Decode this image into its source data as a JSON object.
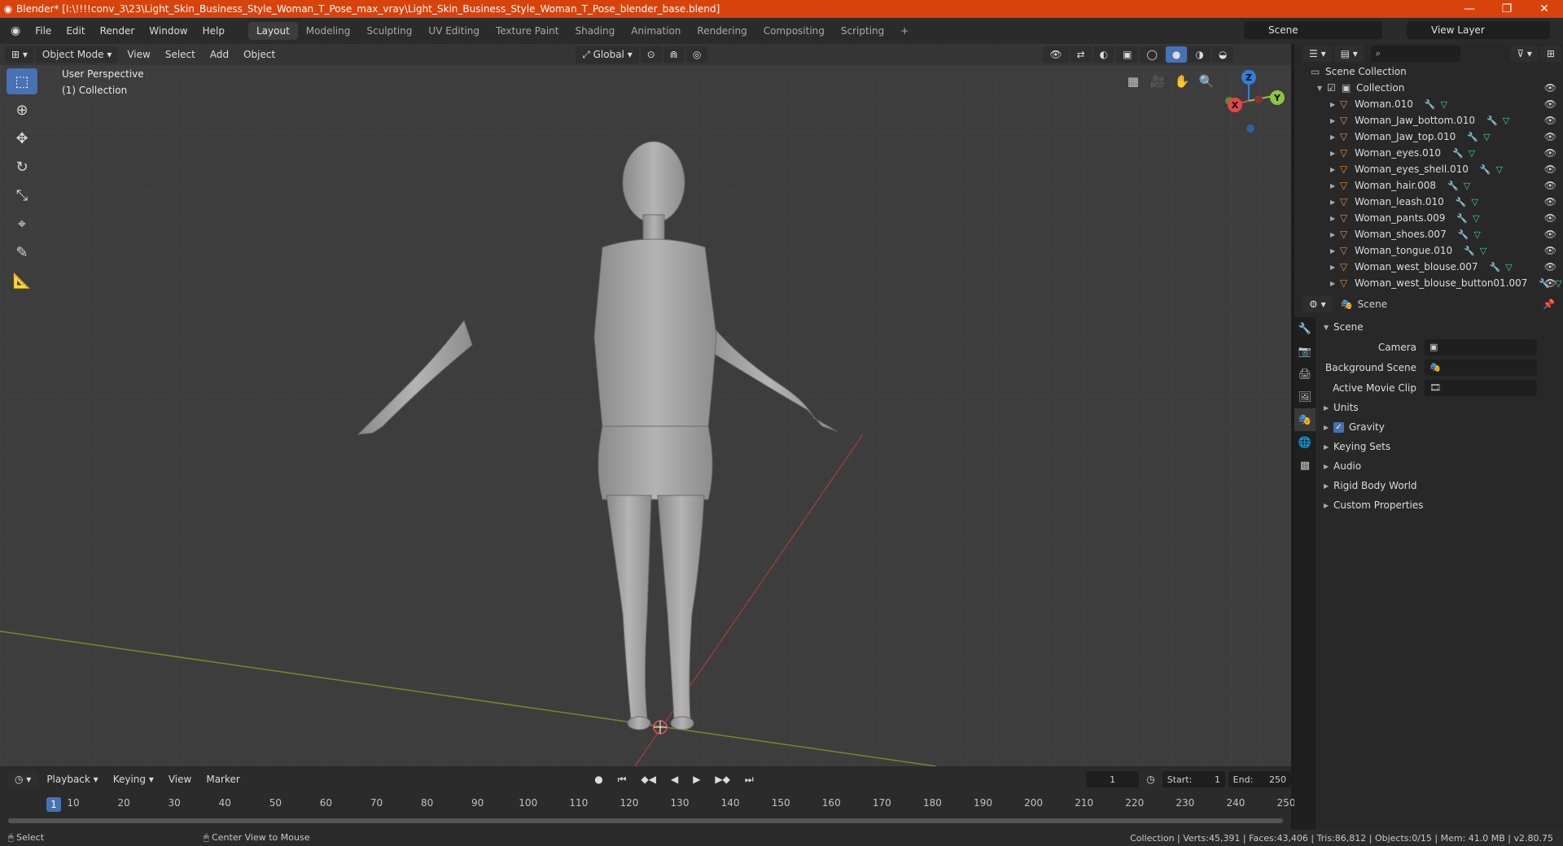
{
  "app": {
    "title": "Blender* [I:\\!!!!conv_3\\23\\Light_Skin_Business_Style_Woman_T_Pose_max_vray\\Light_Skin_Business_Style_Woman_T_Pose_blender_base.blend]",
    "logo_glyph": "◉",
    "controls": {
      "minimize": "—",
      "maximize": "❐",
      "close": "✕"
    }
  },
  "menu": [
    "File",
    "Edit",
    "Render",
    "Window",
    "Help"
  ],
  "workspaces": [
    "Layout",
    "Modeling",
    "Sculpting",
    "UV Editing",
    "Texture Paint",
    "Shading",
    "Animation",
    "Rendering",
    "Compositing",
    "Scripting"
  ],
  "active_workspace": "Layout",
  "add_workspace": "+",
  "scene_name": "Scene",
  "view_layer": "View Layer",
  "viewport": {
    "mode": "Object Mode",
    "menus": [
      "View",
      "Select",
      "Add",
      "Object"
    ],
    "transform_orientation": "Global",
    "perspective_label": "User Perspective",
    "collection_label": "(1) Collection",
    "gizmo": {
      "x": "X",
      "y": "Y",
      "z": "Z"
    }
  },
  "outliner": {
    "root": "Scene Collection",
    "collection": "Collection",
    "items": [
      "Woman.010",
      "Woman_Jaw_bottom.010",
      "Woman_Jaw_top.010",
      "Woman_eyes.010",
      "Woman_eyes_shell.010",
      "Woman_hair.008",
      "Woman_leash.010",
      "Woman_pants.009",
      "Woman_shoes.007",
      "Woman_tongue.010",
      "Woman_west_blouse.007",
      "Woman_west_blouse_button01.007"
    ]
  },
  "properties": {
    "context": "Scene",
    "section": "Scene",
    "camera_label": "Camera",
    "background_scene_label": "Background Scene",
    "active_movie_clip_label": "Active Movie Clip",
    "subsections": [
      "Units",
      "Gravity",
      "Keying Sets",
      "Audio",
      "Rigid Body World",
      "Custom Properties"
    ],
    "gravity_checked": true
  },
  "timeline": {
    "menus": [
      "Playback",
      "Keying",
      "View",
      "Marker"
    ],
    "current_frame": "1",
    "start_label": "Start:",
    "start": "1",
    "end_label": "End:",
    "end": "250",
    "ruler": [
      "10",
      "20",
      "30",
      "40",
      "50",
      "60",
      "70",
      "80",
      "90",
      "100",
      "110",
      "120",
      "130",
      "140",
      "150",
      "160",
      "170",
      "180",
      "190",
      "200",
      "210",
      "220",
      "230",
      "240",
      "250"
    ],
    "ruler_current": "1"
  },
  "status": {
    "left": "Select",
    "middle": "Center View to Mouse",
    "right": "Collection | Verts:45,391 | Faces:43,406 | Tris:86,812 | Objects:0/15 | Mem: 41.0 MB | v2.80.75"
  }
}
